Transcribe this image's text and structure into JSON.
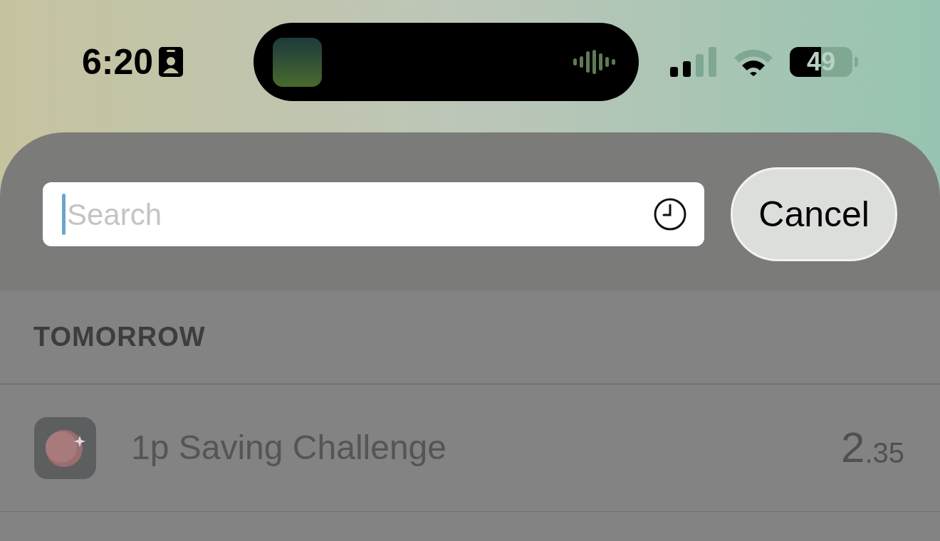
{
  "status_bar": {
    "time": "6:20",
    "battery": "49"
  },
  "search": {
    "placeholder": "Search",
    "focused": true,
    "cancel_label": "Cancel"
  },
  "sections": [
    {
      "header": "TOMORROW",
      "rows": [
        {
          "name": "1p Saving Challenge",
          "amount_whole": "2",
          "amount_fraction": ".35"
        }
      ]
    }
  ]
}
